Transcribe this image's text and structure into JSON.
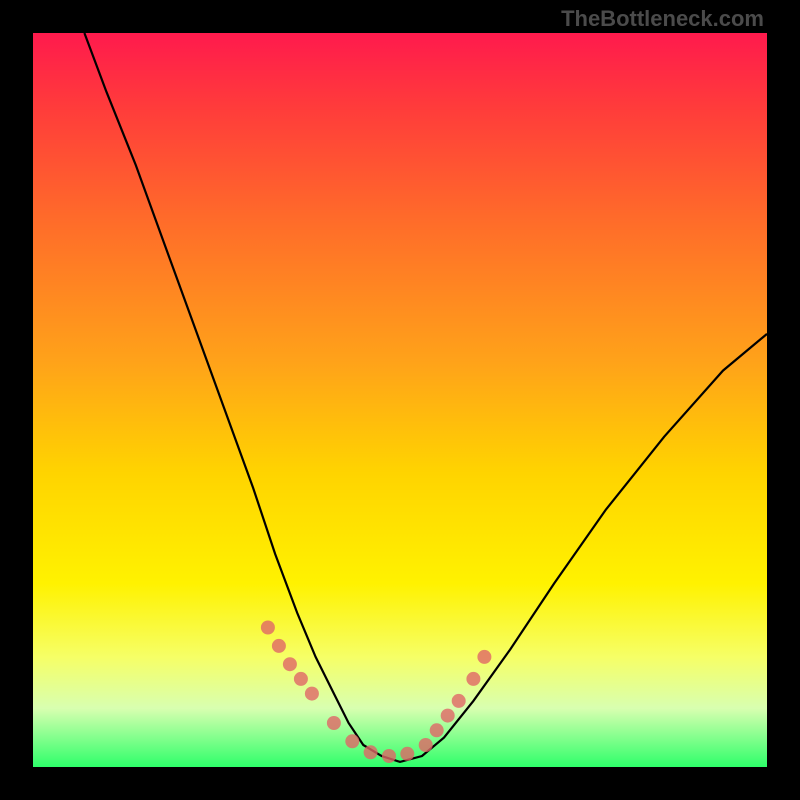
{
  "watermark": "TheBottleneck.com",
  "chart_data": {
    "type": "line",
    "title": "",
    "xlabel": "",
    "ylabel": "",
    "xlim": [
      0,
      100
    ],
    "ylim": [
      0,
      100
    ],
    "grid": false,
    "background_gradient": {
      "direction": "vertical",
      "stops": [
        {
          "pos": 0,
          "color": "#ff1a4d"
        },
        {
          "pos": 10,
          "color": "#ff3b3b"
        },
        {
          "pos": 25,
          "color": "#ff6a2a"
        },
        {
          "pos": 45,
          "color": "#ffa319"
        },
        {
          "pos": 60,
          "color": "#ffd400"
        },
        {
          "pos": 75,
          "color": "#fff200"
        },
        {
          "pos": 85,
          "color": "#f6ff66"
        },
        {
          "pos": 92,
          "color": "#d8ffb0"
        },
        {
          "pos": 100,
          "color": "#2eff6a"
        }
      ]
    },
    "series": [
      {
        "name": "bottleneck-curve",
        "type": "line",
        "color": "#000000",
        "x": [
          7,
          10,
          14,
          18,
          22,
          26,
          30,
          33,
          36,
          38.5,
          41,
          43,
          45,
          47.5,
          50,
          53,
          56,
          60,
          65,
          71,
          78,
          86,
          94,
          100
        ],
        "y": [
          100,
          92,
          82,
          71,
          60,
          49,
          38,
          29,
          21,
          15,
          10,
          6,
          3,
          1.5,
          0.7,
          1.5,
          4,
          9,
          16,
          25,
          35,
          45,
          54,
          59
        ]
      },
      {
        "name": "marker-points",
        "type": "scatter",
        "color": "#e06666",
        "x": [
          32,
          33.5,
          35,
          36.5,
          38,
          41,
          43.5,
          46,
          48.5,
          51,
          53.5,
          55,
          56.5,
          58,
          60,
          61.5
        ],
        "y": [
          19,
          16.5,
          14,
          12,
          10,
          6,
          3.5,
          2,
          1.5,
          1.8,
          3,
          5,
          7,
          9,
          12,
          15
        ]
      }
    ]
  }
}
